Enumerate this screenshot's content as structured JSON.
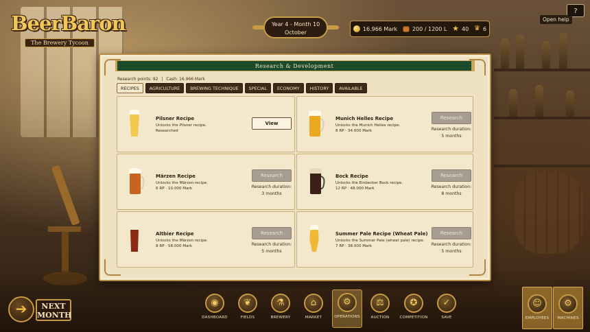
{
  "logo": {
    "title": "BeerBaron",
    "subtitle": "The Brewery Tycoon"
  },
  "date": {
    "line1": "Year 4 - Month 10",
    "line2": "October"
  },
  "resources": {
    "money": "16.966 Mark",
    "storage": "200 / 1200 L",
    "reputation": "40",
    "prestige": "6"
  },
  "help": {
    "button": "?",
    "label": "Open help"
  },
  "panel": {
    "title": "Research & Development",
    "points_text": "Research points: 92",
    "separator": "|",
    "cash_text": "Cash: 16.966 Mark",
    "tabs": [
      "RECIPES",
      "AGRICULTURE",
      "BREWING TECHNIQUE",
      "SPECIAL",
      "ECONOMY",
      "HISTORY",
      "AVAILABLE"
    ],
    "active_tab": "RECIPES",
    "cards": [
      {
        "name": "Pilsner Recipe",
        "desc": "Unlocks the Pilsner recipe.",
        "info": "Researched",
        "button": "View",
        "state": "researched",
        "beer_color": "#f2c94c"
      },
      {
        "name": "Munich Helles Recipe",
        "desc": "Unlocks the Munich Helles recipe.",
        "info": "8 RP · 34.000 Mark",
        "button": "Research",
        "duration_label": "Research duration:",
        "duration": "5 months",
        "beer_color": "#eaa920"
      },
      {
        "name": "Märzen Recipe",
        "desc": "Unlocks the Märzen recipe.",
        "info": "6 RP · 10.000 Mark",
        "button": "Research",
        "duration_label": "Research duration:",
        "duration": "3 months",
        "beer_color": "#c7641e"
      },
      {
        "name": "Bock Recipe",
        "desc": "Unlocks the Einbecker Bock recipe.",
        "info": "12 RP · 48.000 Mark",
        "button": "Research",
        "duration_label": "Research duration:",
        "duration": "8 months",
        "beer_color": "#3a2014"
      },
      {
        "name": "Altbier Recipe",
        "desc": "Unlocks the Märzen recipe.",
        "info": "8 RP · 58.000 Mark",
        "button": "Research",
        "duration_label": "Research duration:",
        "duration": "5 months",
        "beer_color": "#8a2a12"
      },
      {
        "name": "Summer Pale Recipe (Wheat Pale)",
        "desc": "Unlocks the Summer Pale (wheat pale) recipe.",
        "info": "7 RP · 38.000 Mark",
        "button": "Research",
        "duration_label": "Research duration:",
        "duration": "5 months",
        "beer_color": "#f0b935"
      }
    ]
  },
  "next_month": {
    "line1": "NEXT",
    "line2": "MONTH"
  },
  "nav": [
    {
      "label": "DASHBOARD",
      "icon": "dashboard-icon",
      "glyph": "◉"
    },
    {
      "label": "FIELDS",
      "icon": "fields-icon",
      "glyph": "❦"
    },
    {
      "label": "BREWERY",
      "icon": "brewery-icon",
      "glyph": "⚗"
    },
    {
      "label": "MARKET",
      "icon": "market-icon",
      "glyph": "⌂"
    },
    {
      "label": "OPERATIONS",
      "icon": "operations-icon",
      "glyph": "⚙"
    },
    {
      "label": "AUCTION",
      "icon": "auction-icon",
      "glyph": "⚖"
    },
    {
      "label": "COMPETITION",
      "icon": "competition-icon",
      "glyph": "✪"
    },
    {
      "label": "SAVE",
      "icon": "save-icon",
      "glyph": "✓"
    }
  ],
  "nav_active": "OPERATIONS",
  "side_nav": [
    {
      "label": "EMPLOYEES",
      "icon": "employees-icon",
      "glyph": "☺"
    },
    {
      "label": "MACHINES",
      "icon": "machines-icon",
      "glyph": "⚙"
    }
  ],
  "colors": {
    "panel_header": "#1e4a2c",
    "gold": "#c79a45",
    "research_button": "#a79e91"
  }
}
